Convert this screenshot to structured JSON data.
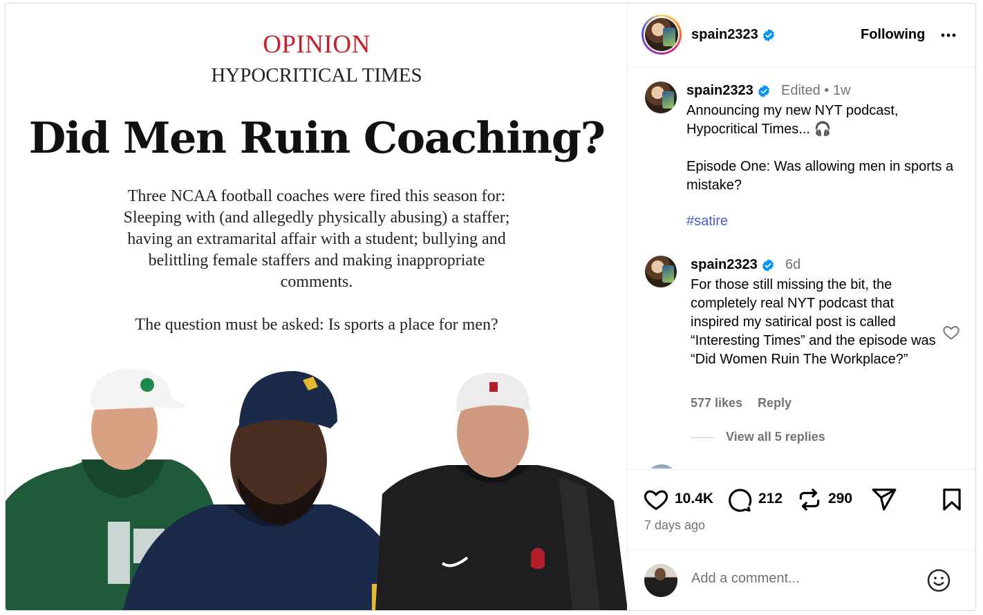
{
  "post": {
    "opinion_label": "OPINION",
    "section": "HYPOCRITICAL TIMES",
    "headline": "Did Men Ruin Coaching?",
    "body": "Three NCAA football coaches were fired this season for: Sleeping with (and allegedly physically abusing) a staffer; having an extramarital affair with a student; bullying and belittling female staffers and making inappropriate comments.",
    "question": "The question must be asked: Is sports a place for men?"
  },
  "header": {
    "username": "spain2323",
    "follow_label": "Following"
  },
  "caption": {
    "username": "spain2323",
    "meta": "Edited • 1w",
    "text": "Announcing my new NYT podcast, Hypocritical Times... 🎧\n\nEpisode One: Was allowing men in sports a mistake?",
    "hashtag": "#satire"
  },
  "comment": {
    "username": "spain2323",
    "time": "6d",
    "text": "For those still missing the bit, the completely real NYT podcast that inspired my satirical post is called “Interesting Times” and the episode was “Did Women Ruin The Workplace?”",
    "likes": "577 likes",
    "reply_label": "Reply",
    "view_replies": "View all 5 replies"
  },
  "actions": {
    "likes": "10.4K",
    "comments": "212",
    "reposts": "290",
    "posted": "7 days ago"
  },
  "add_comment": {
    "placeholder": "Add a comment..."
  },
  "colors": {
    "opinion_red": "#c8202b",
    "hashtag_blue": "#4a5dd8",
    "verified_blue": "#0095f6",
    "muted_gray": "#737373"
  }
}
